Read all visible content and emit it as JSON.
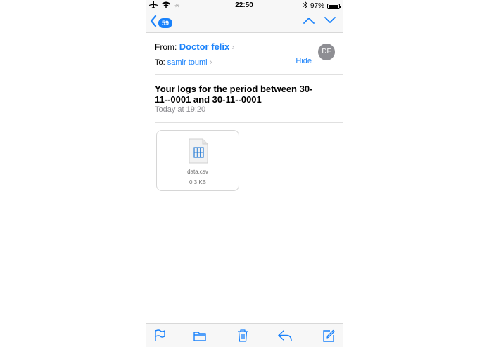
{
  "status_bar": {
    "time": "22:50",
    "battery": "97%",
    "battery_level": 0.97
  },
  "nav": {
    "unread_count": "59"
  },
  "message": {
    "from_label": "From:",
    "from_name": "Doctor felix",
    "avatar_initials": "DF",
    "to_label": "To:",
    "to_name": "samir toumi",
    "hide_label": "Hide",
    "subject": "Your logs for the period between 30-11--0001 and 30-11--0001",
    "date": "Today at 19:20"
  },
  "attachment": {
    "filename": "data.csv",
    "size": "0.3 KB"
  },
  "colors": {
    "accent": "#1a82fb",
    "muted": "#8e8e93",
    "bar_bg": "#f7f7f7"
  }
}
